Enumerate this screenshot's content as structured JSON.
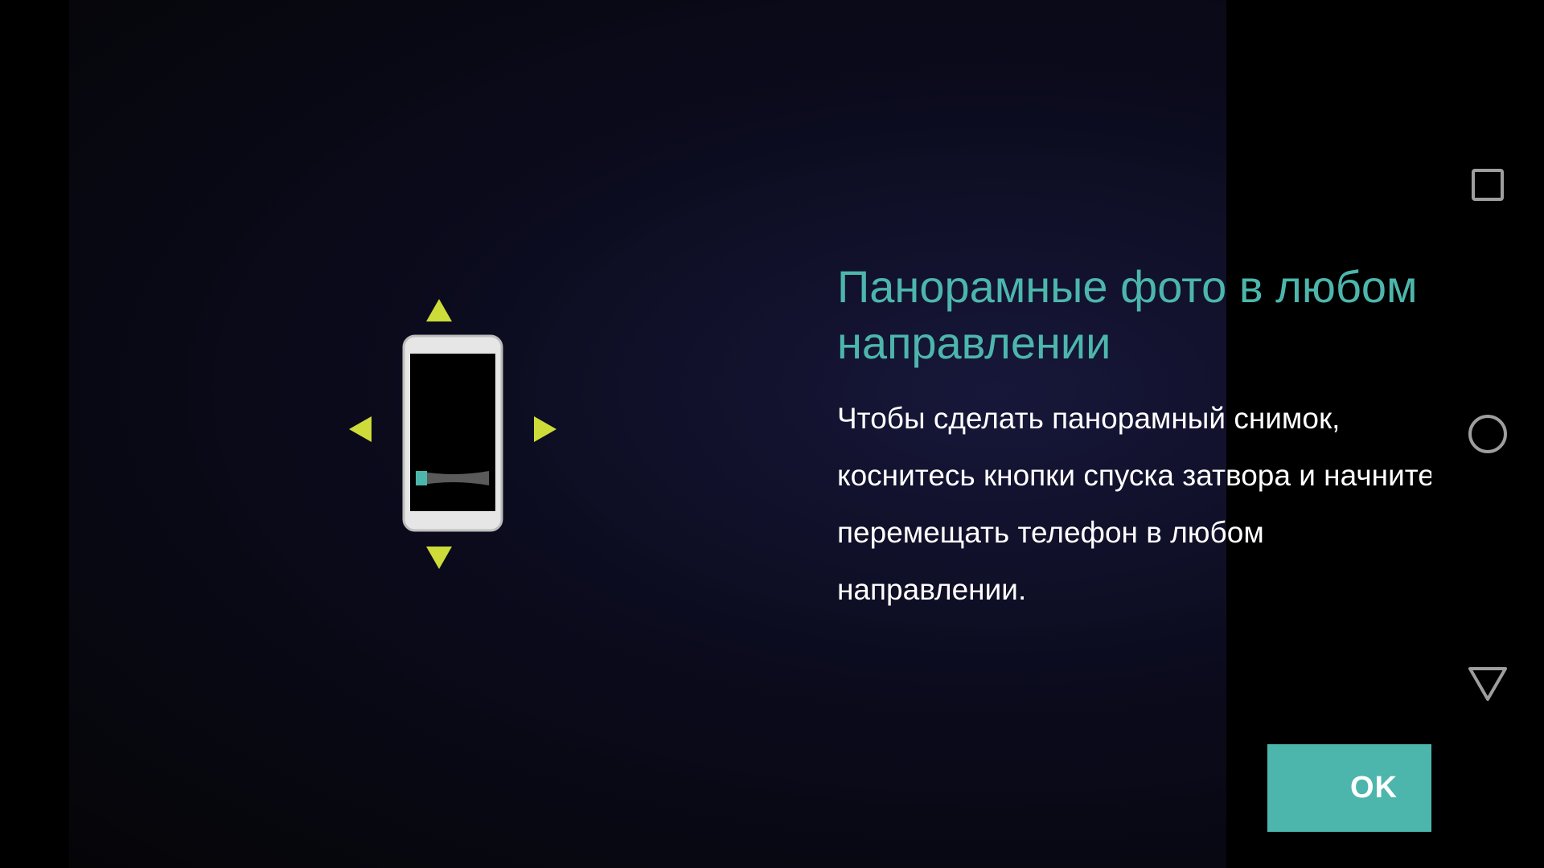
{
  "tutorial": {
    "title": "Панорамные фото в любом направлении",
    "body": "Чтобы сделать панорамный снимок, коснитесь кнопки спуска затвора и начните перемещать телефон в любом направлении.",
    "ok_label": "OK"
  },
  "navbar": {
    "icons": [
      "recents-icon",
      "home-icon",
      "back-icon"
    ]
  },
  "colors": {
    "accent": "#4DB6AC",
    "arrow": "#CDDC39",
    "phone_body": "#E0E0E0"
  }
}
